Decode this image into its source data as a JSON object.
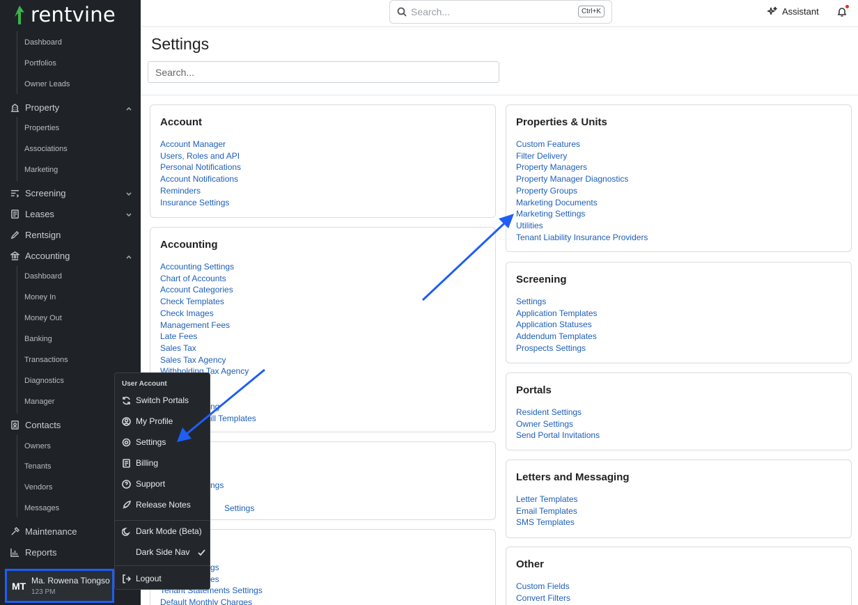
{
  "app": {
    "logo_text": "rentvine"
  },
  "topbar": {
    "search_placeholder": "Search...",
    "shortcut": "Ctrl+K",
    "assistant_label": "Assistant"
  },
  "sidebar": {
    "portfolio_subitems": [
      "Dashboard",
      "Portfolios",
      "Owner Leads"
    ],
    "property": {
      "label": "Property",
      "subitems": [
        "Properties",
        "Associations",
        "Marketing"
      ]
    },
    "screening": {
      "label": "Screening"
    },
    "leases": {
      "label": "Leases"
    },
    "rentsign": {
      "label": "Rentsign"
    },
    "accounting": {
      "label": "Accounting",
      "subitems": [
        "Dashboard",
        "Money In",
        "Money Out",
        "Banking",
        "Transactions",
        "Diagnostics",
        "Manager"
      ]
    },
    "contacts": {
      "label": "Contacts",
      "subitems": [
        "Owners",
        "Tenants",
        "Vendors",
        "Messages"
      ]
    },
    "maintenance": {
      "label": "Maintenance"
    },
    "reports": {
      "label": "Reports"
    },
    "user": {
      "initials": "MT",
      "name": "Ma. Rowena Tiongso",
      "time": "123 PM"
    }
  },
  "page": {
    "title": "Settings",
    "search_placeholder": "Search..."
  },
  "cards": {
    "account": {
      "title": "Account",
      "links": [
        "Account Manager",
        "Users, Roles and API",
        "Personal Notifications",
        "Account Notifications",
        "Reminders",
        "Insurance Settings"
      ]
    },
    "accounting": {
      "title": "Accounting",
      "links": [
        "Accounting Settings",
        "Chart of Accounts",
        "Account Categories",
        "Check Templates",
        "Check Images",
        "Management Fees",
        "Late Fees",
        "Sales Tax",
        "Sales Tax Agency",
        "Withholding Tax Agency"
      ]
    },
    "accounting_hidden": {
      "links": [
        "ng",
        "ill Templates"
      ]
    },
    "leases_partial": {
      "links": [
        "ngs",
        "Settings"
      ]
    },
    "tenants_partial": {
      "links": [
        "gs",
        "es",
        "Tenant Statements Settings",
        "Default Monthly Charges"
      ]
    },
    "properties": {
      "title": "Properties & Units",
      "links": [
        "Custom Features",
        "Filter Delivery",
        "Property Managers",
        "Property Manager Diagnostics",
        "Property Groups",
        "Marketing Documents",
        "Marketing Settings",
        "Utilities",
        "Tenant Liability Insurance Providers"
      ]
    },
    "screening": {
      "title": "Screening",
      "links": [
        "Settings",
        "Application Templates",
        "Application Statuses",
        "Addendum Templates",
        "Prospects Settings"
      ]
    },
    "portals": {
      "title": "Portals",
      "links": [
        "Resident Settings",
        "Owner Settings",
        "Send Portal Invitations"
      ]
    },
    "letters": {
      "title": "Letters and Messaging",
      "links": [
        "Letter Templates",
        "Email Templates",
        "SMS Templates"
      ]
    },
    "other": {
      "title": "Other",
      "links": [
        "Custom Fields",
        "Convert Filters"
      ]
    }
  },
  "user_menu": {
    "header": "User Account",
    "items": [
      "Switch Portals",
      "My Profile",
      "Settings",
      "Billing",
      "Support",
      "Release Notes",
      "Dark Mode (Beta)",
      "Dark Side Nav",
      "Logout"
    ]
  },
  "colors": {
    "sidebar_bg": "#1f2327",
    "link": "#1d5fb8",
    "annotation_blue": "#1f5ef5",
    "logo_green": "#3bb44a"
  }
}
